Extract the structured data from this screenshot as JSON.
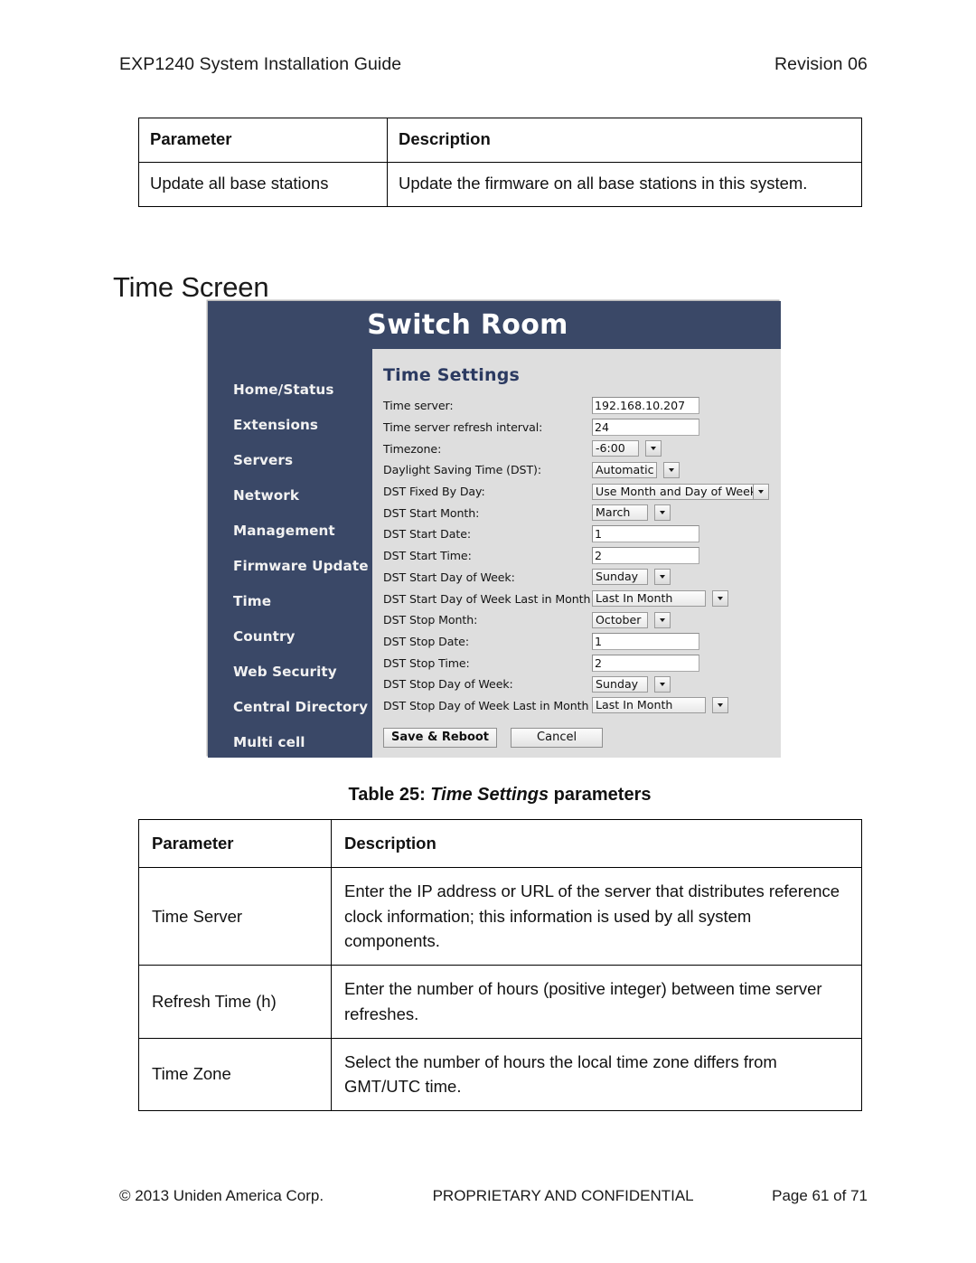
{
  "header": {
    "left": "EXP1240 System Installation Guide",
    "right": "Revision 06"
  },
  "top_table": {
    "columns": [
      "Parameter",
      "Description"
    ],
    "rows": [
      [
        "Update all base stations",
        "Update the firmware on all base stations in this system."
      ]
    ]
  },
  "section": {
    "heading": "Time Screen"
  },
  "screenshot": {
    "title": "Switch Room",
    "panel_title": "Time Settings",
    "nav": [
      "Home/Status",
      "Extensions",
      "Servers",
      "Network",
      "Management",
      "Firmware Update",
      "Time",
      "Country",
      "Web Security",
      "Central Directory",
      "Multi cell"
    ],
    "fields": [
      {
        "label": "Time server:",
        "type": "text",
        "value": "192.168.10.207"
      },
      {
        "label": "Time server refresh interval:",
        "type": "text",
        "value": "24"
      },
      {
        "label": "Timezone:",
        "type": "select-split",
        "value": "-6:00",
        "text_width": "52px"
      },
      {
        "label": "Daylight Saving Time (DST):",
        "type": "select-split",
        "value": "Automatic",
        "text_width": "72px"
      },
      {
        "label": "DST Fixed By Day:",
        "type": "select",
        "value": "Use Month and Day of Week",
        "text_width": "170px"
      },
      {
        "label": "DST Start Month:",
        "type": "select-split",
        "value": "March",
        "text_width": "62px"
      },
      {
        "label": "DST Start Date:",
        "type": "text",
        "value": "1"
      },
      {
        "label": "DST Start Time:",
        "type": "text",
        "value": "2"
      },
      {
        "label": "DST Start Day of Week:",
        "type": "select-split",
        "value": "Sunday",
        "text_width": "62px"
      },
      {
        "label": "DST Start Day of Week Last in Month",
        "type": "select-split",
        "value": "Last In Month",
        "text_width": "126px"
      },
      {
        "label": "DST Stop Month:",
        "type": "select-split",
        "value": "October",
        "text_width": "62px"
      },
      {
        "label": "DST Stop Date:",
        "type": "text",
        "value": "1"
      },
      {
        "label": "DST Stop Time:",
        "type": "text",
        "value": "2"
      },
      {
        "label": "DST Stop Day of Week:",
        "type": "select-split",
        "value": "Sunday",
        "text_width": "62px"
      },
      {
        "label": "DST Stop Day of Week Last in Month",
        "type": "select-split",
        "value": "Last In Month",
        "text_width": "126px"
      }
    ],
    "buttons": {
      "save": "Save & Reboot",
      "cancel": "Cancel"
    },
    "colors": {
      "chrome": "#3a4867",
      "panel": "#dedede",
      "panel_title": "#2b3a61"
    }
  },
  "table_caption": {
    "prefix": "Table 25: ",
    "italic": "Time Settings",
    "suffix": " parameters"
  },
  "bottom_table": {
    "columns": [
      "Parameter",
      "Description"
    ],
    "rows": [
      [
        "Time Server",
        "Enter the IP address or URL of the server that distributes reference clock information; this information is used by all system components."
      ],
      [
        "Refresh Time (h)",
        "Enter the number of hours (positive integer) between time server refreshes."
      ],
      [
        "Time Zone",
        "Select the number of hours the local time zone differs from GMT/UTC time."
      ]
    ]
  },
  "footer": {
    "left": "© 2013 Uniden America Corp.",
    "middle": "PROPRIETARY AND CONFIDENTIAL",
    "right": "Page 61 of 71"
  }
}
